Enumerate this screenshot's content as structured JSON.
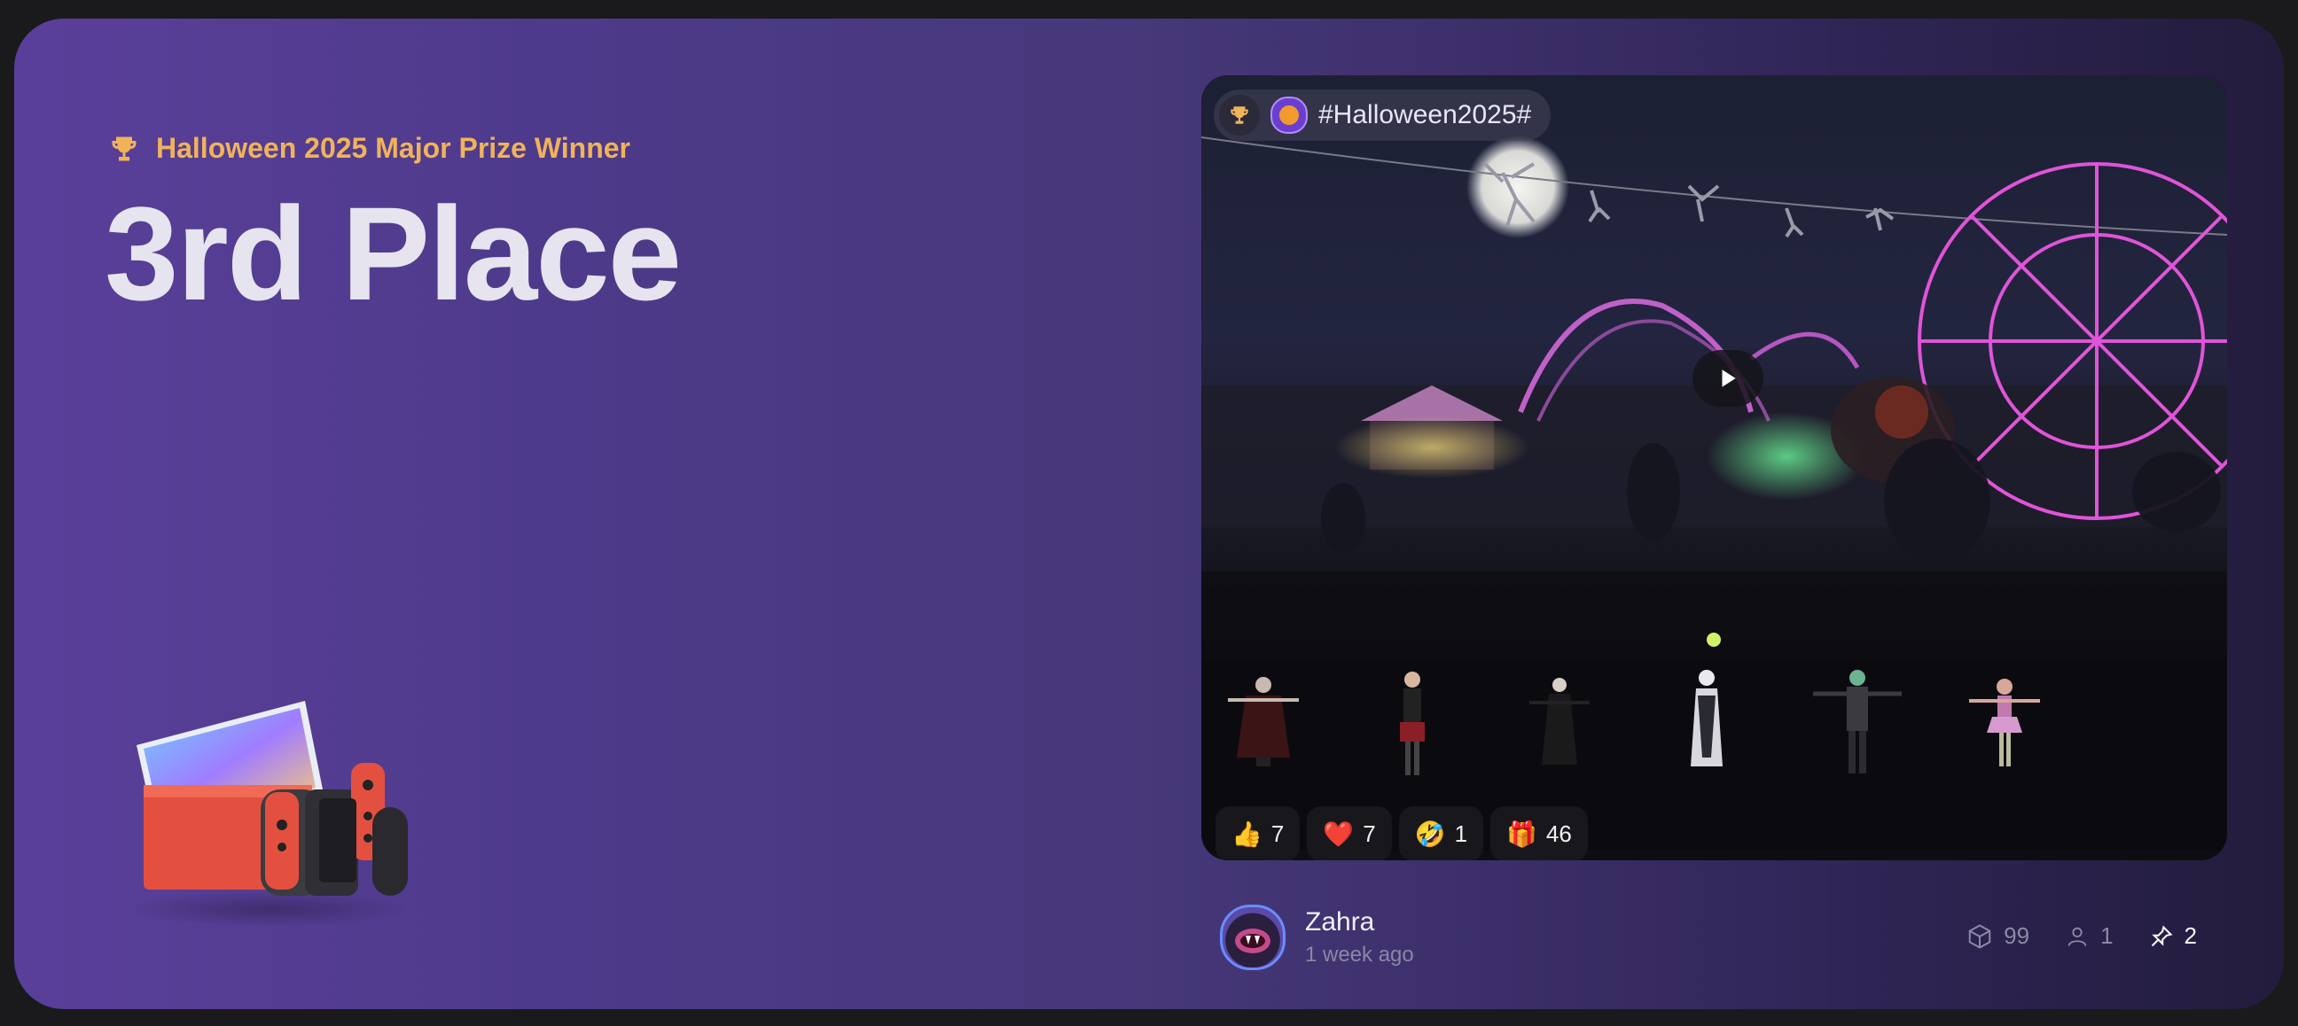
{
  "award": {
    "prize_label": "Halloween 2025 Major Prize Winner",
    "place": "3rd Place",
    "prize_item_icon": "game-console-image"
  },
  "post": {
    "hashtag": "#Halloween2025#",
    "reactions": [
      {
        "icon": "👍",
        "count": "7"
      },
      {
        "icon": "❤️",
        "count": "7"
      },
      {
        "icon": "🤣",
        "count": "1"
      },
      {
        "icon": "🎁",
        "count": "46"
      }
    ],
    "author": {
      "name": "Zahra",
      "time": "1 week ago"
    },
    "stats": {
      "models": "99",
      "users": "1",
      "pins": "2"
    }
  },
  "colors": {
    "prize_text": "#f0b35a",
    "place_text": "#e6e4ee",
    "indicator": "#d3f06a"
  }
}
